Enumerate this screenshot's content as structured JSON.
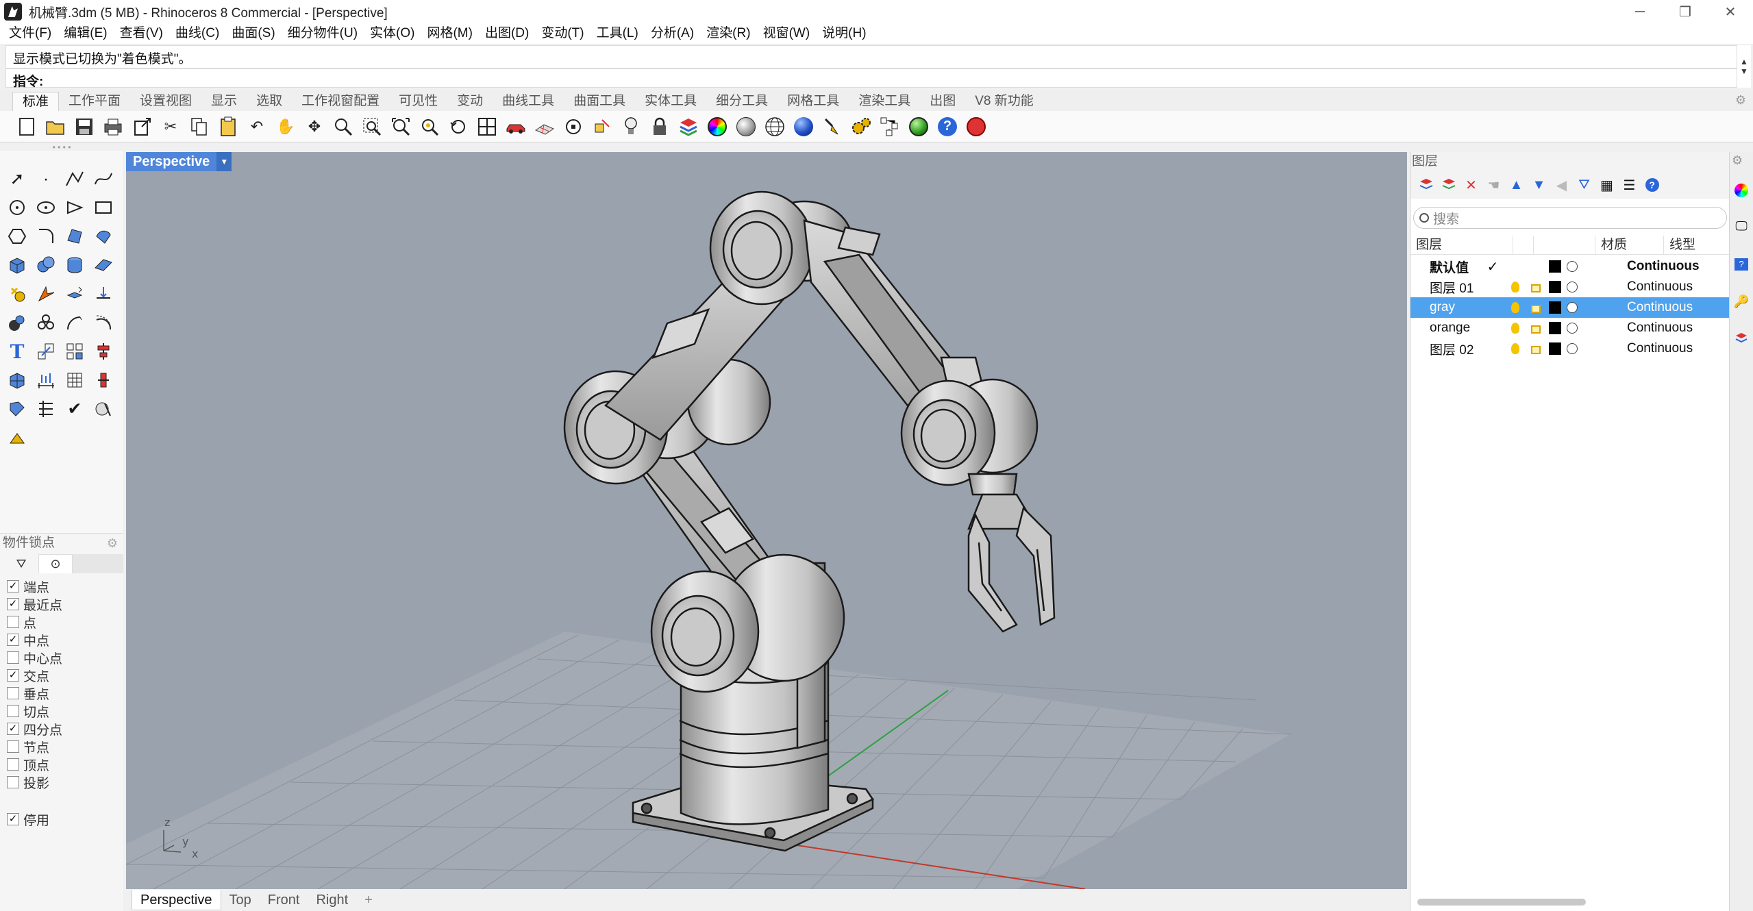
{
  "window": {
    "title": "机械臂.3dm (5 MB) - Rhinoceros 8 Commercial - [Perspective]",
    "minimize": "─",
    "restore": "❐",
    "close": "✕"
  },
  "menu": [
    "文件(F)",
    "编辑(E)",
    "查看(V)",
    "曲线(C)",
    "曲面(S)",
    "细分物件(U)",
    "实体(O)",
    "网格(M)",
    "出图(D)",
    "变动(T)",
    "工具(L)",
    "分析(A)",
    "渲染(R)",
    "视窗(W)",
    "说明(H)"
  ],
  "command": {
    "history": "显示模式已切换为\"着色模式\"。",
    "prompt": "指令:"
  },
  "toolbar_tabs": [
    "标准",
    "工作平面",
    "设置视图",
    "显示",
    "选取",
    "工作视窗配置",
    "可见性",
    "变动",
    "曲线工具",
    "曲面工具",
    "实体工具",
    "细分工具",
    "网格工具",
    "渲染工具",
    "出图",
    "V8 新功能"
  ],
  "osnap": {
    "title": "物件锁点",
    "items": [
      {
        "label": "端点",
        "checked": true
      },
      {
        "label": "最近点",
        "checked": true
      },
      {
        "label": "点",
        "checked": false
      },
      {
        "label": "中点",
        "checked": true
      },
      {
        "label": "中心点",
        "checked": false
      },
      {
        "label": "交点",
        "checked": true
      },
      {
        "label": "垂点",
        "checked": false
      },
      {
        "label": "切点",
        "checked": false
      },
      {
        "label": "四分点",
        "checked": true
      },
      {
        "label": "节点",
        "checked": false
      },
      {
        "label": "顶点",
        "checked": false
      },
      {
        "label": "投影",
        "checked": false
      }
    ],
    "disable": {
      "label": "停用",
      "checked": true
    },
    "check_mark": "✓"
  },
  "viewport": {
    "label": "Perspective",
    "axis_labels": {
      "z": "z",
      "y": "y",
      "x": "x"
    },
    "tabs": [
      "Perspective",
      "Top",
      "Front",
      "Right"
    ],
    "add_tab": "+",
    "colors": {
      "background": "#9aa2ad",
      "grid": "#8a919b",
      "x_axis": "#c0392b",
      "y_axis": "#2ea043",
      "model": "#c9c9c9"
    }
  },
  "layers": {
    "panel_title": "图层",
    "search_placeholder": "搜索",
    "columns": {
      "name": "图层",
      "material": "材质",
      "linetype": "线型"
    },
    "rows": [
      {
        "name": "默认值",
        "current": true,
        "linetype": "Continuous",
        "bold": true
      },
      {
        "name": "图层 01",
        "current": false,
        "linetype": "Continuous",
        "bold": false
      },
      {
        "name": "gray",
        "current": false,
        "linetype": "Continuous",
        "bold": false,
        "selected": true
      },
      {
        "name": "orange",
        "current": false,
        "linetype": "Continuous",
        "bold": false
      },
      {
        "name": "图层 02",
        "current": false,
        "linetype": "Continuous",
        "bold": false
      }
    ],
    "current_mark": "✓",
    "selection_color": "#4fa3ee"
  }
}
